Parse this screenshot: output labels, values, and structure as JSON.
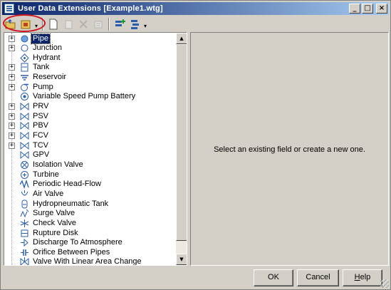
{
  "window": {
    "title": "User Data Extensions [Example1.wtg]",
    "title_buttons": {
      "minimize": "_",
      "maximize": "□",
      "close": "×"
    }
  },
  "toolbar": {
    "items": [
      {
        "icon": "open-folder-icon",
        "enabled": true
      },
      {
        "icon": "save-export-icon",
        "enabled": true
      },
      {
        "icon": "new-document-icon",
        "enabled": true
      },
      {
        "icon": "copy-document-icon",
        "enabled": false
      },
      {
        "icon": "delete-x-icon",
        "enabled": false
      },
      {
        "icon": "rename-icon",
        "enabled": false
      },
      {
        "icon": "add-field-icon",
        "enabled": true
      },
      {
        "icon": "sort-fields-icon",
        "enabled": true
      }
    ],
    "dropdown_glyph": "▾"
  },
  "tree": {
    "items": [
      {
        "label": "Pipe",
        "icon": "pipe-icon",
        "expandable": true,
        "selected": true
      },
      {
        "label": "Junction",
        "icon": "junction-icon",
        "expandable": true
      },
      {
        "label": "Hydrant",
        "icon": "hydrant-icon",
        "expandable": false
      },
      {
        "label": "Tank",
        "icon": "tank-icon",
        "expandable": true
      },
      {
        "label": "Reservoir",
        "icon": "reservoir-icon",
        "expandable": true
      },
      {
        "label": "Pump",
        "icon": "pump-icon",
        "expandable": true
      },
      {
        "label": "Variable Speed Pump Battery",
        "icon": "pump-battery-icon",
        "expandable": false
      },
      {
        "label": "PRV",
        "icon": "valve-icon",
        "expandable": true
      },
      {
        "label": "PSV",
        "icon": "valve-icon",
        "expandable": true
      },
      {
        "label": "PBV",
        "icon": "valve-icon",
        "expandable": true
      },
      {
        "label": "FCV",
        "icon": "valve-icon",
        "expandable": true
      },
      {
        "label": "TCV",
        "icon": "valve-icon",
        "expandable": true
      },
      {
        "label": "GPV",
        "icon": "valve-icon",
        "expandable": false
      },
      {
        "label": "Isolation Valve",
        "icon": "isolation-valve-icon",
        "expandable": false
      },
      {
        "label": "Turbine",
        "icon": "turbine-icon",
        "expandable": false
      },
      {
        "label": "Periodic Head-Flow",
        "icon": "periodic-head-flow-icon",
        "expandable": false
      },
      {
        "label": "Air Valve",
        "icon": "air-valve-icon",
        "expandable": false
      },
      {
        "label": "Hydropneumatic Tank",
        "icon": "hydropneumatic-tank-icon",
        "expandable": false
      },
      {
        "label": "Surge Valve",
        "icon": "surge-valve-icon",
        "expandable": false
      },
      {
        "label": "Check Valve",
        "icon": "check-valve-icon",
        "expandable": false
      },
      {
        "label": "Rupture Disk",
        "icon": "rupture-disk-icon",
        "expandable": false
      },
      {
        "label": "Discharge To Atmosphere",
        "icon": "discharge-icon",
        "expandable": false
      },
      {
        "label": "Orifice Between Pipes",
        "icon": "orifice-icon",
        "expandable": false
      },
      {
        "label": "Valve With Linear Area Change",
        "icon": "linear-valve-icon",
        "expandable": false
      }
    ],
    "expander_glyph": "+",
    "scroll_up_glyph": "▲",
    "scroll_down_glyph": "▼"
  },
  "detail": {
    "message": "Select an existing field or create a new one."
  },
  "buttons": {
    "ok": "OK",
    "cancel": "Cancel",
    "help_prefix": "H",
    "help_rest": "elp"
  },
  "colors": {
    "title_start": "#0a246a",
    "title_end": "#a6caf0",
    "selection": "#0a246a",
    "highlight_ring": "#d0141e",
    "icon_blue": "#2a5db0"
  }
}
